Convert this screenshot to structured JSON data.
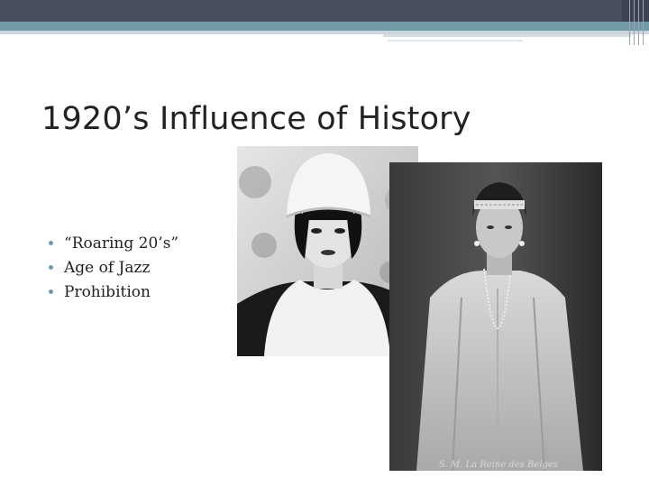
{
  "slide": {
    "title": "1920’s Influence of History",
    "bullets": [
      "“Roaring 20’s”",
      "Age of Jazz",
      "Prohibition"
    ]
  },
  "images": {
    "photo1": {
      "caption": ""
    },
    "photo2": {
      "caption": "S. M. La Reine des Belges"
    }
  },
  "colors": {
    "top_bar": "#4a4f5e",
    "accent_teal": "#6f9aa6",
    "title_text": "#222222"
  }
}
